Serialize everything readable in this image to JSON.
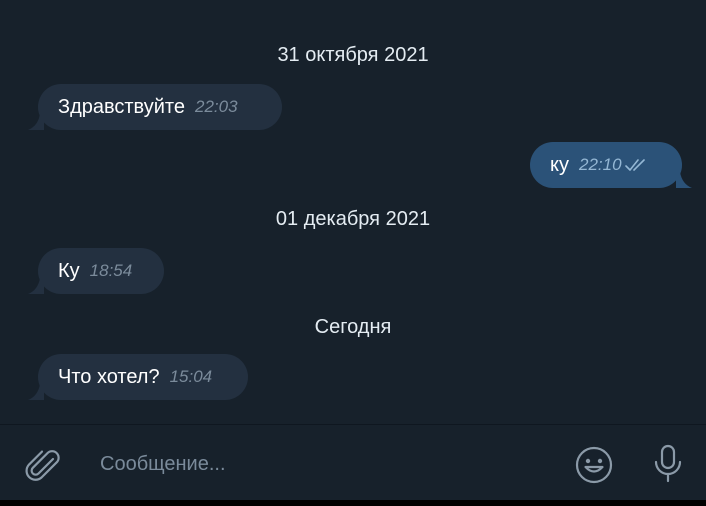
{
  "chat": {
    "dates": [
      "31 октября 2021",
      "01 декабря 2021",
      "Сегодня"
    ],
    "messages": [
      {
        "text": "Здравствуйте",
        "time": "22:03",
        "direction": "incoming"
      },
      {
        "text": "ку",
        "time": "22:10",
        "direction": "outgoing",
        "status": "read"
      },
      {
        "text": "Ку",
        "time": "18:54",
        "direction": "incoming"
      },
      {
        "text": "Что хотел?",
        "time": "15:04",
        "direction": "incoming"
      }
    ]
  },
  "composer": {
    "placeholder": "Сообщение...",
    "icons": [
      "attach-icon",
      "emoji-icon",
      "microphone-icon"
    ]
  },
  "colors": {
    "background": "#17212b",
    "incoming_bubble": "#233040",
    "outgoing_bubble": "#2b5278",
    "check_marks": "#94b7d4"
  }
}
